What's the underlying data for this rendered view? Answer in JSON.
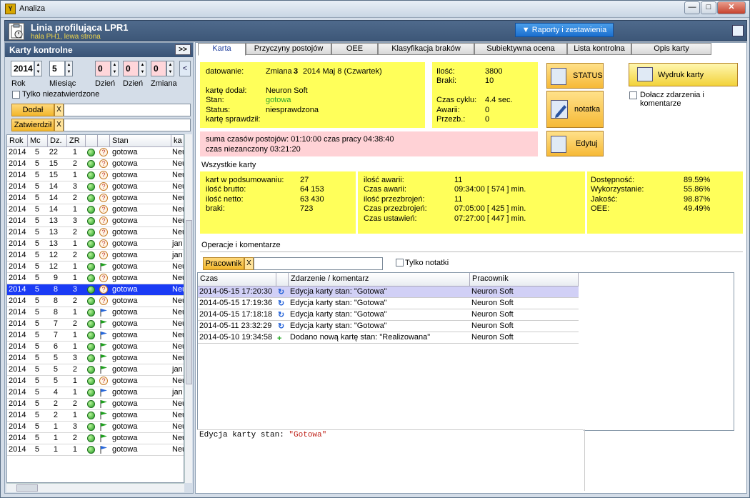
{
  "window": {
    "title": "Analiza",
    "app_icon_letters": "Y",
    "btn_min": "—",
    "btn_max": "□",
    "btn_close": "✕"
  },
  "header": {
    "title": "Linia profilująca LPR1",
    "subtitle": "hala PH1, lewa strona",
    "reports_button": "Raporty i zestawienia"
  },
  "left": {
    "panel_title": "Karty kontrolne",
    "expand_button": ">>",
    "year": "2014",
    "month": "5",
    "day1": "0",
    "day2": "0",
    "shift": "0",
    "collapse_button": "<",
    "label_year": "Rok",
    "label_month": "Miesiąc",
    "label_day1": "Dzień",
    "label_day2": "Dzień",
    "label_shift": "Zmiana",
    "only_unapproved": "Tylko niezatwierdzone",
    "added_button": "Dodał",
    "approved_button": "Zatwierdził",
    "x_label": "X",
    "columns": [
      "Rok",
      "Mc",
      "Dz.",
      "ZR",
      "",
      "",
      "Stan",
      "ka"
    ],
    "rows": [
      {
        "rok": "2014",
        "mc": "5",
        "dz": "22",
        "zr": "1",
        "status": "q",
        "stan": "gotowa",
        "ka": "Neu"
      },
      {
        "rok": "2014",
        "mc": "5",
        "dz": "15",
        "zr": "2",
        "status": "q",
        "stan": "gotowa",
        "ka": "Neu"
      },
      {
        "rok": "2014",
        "mc": "5",
        "dz": "15",
        "zr": "1",
        "status": "q",
        "stan": "gotowa",
        "ka": "Neu"
      },
      {
        "rok": "2014",
        "mc": "5",
        "dz": "14",
        "zr": "3",
        "status": "q",
        "stan": "gotowa",
        "ka": "Neu"
      },
      {
        "rok": "2014",
        "mc": "5",
        "dz": "14",
        "zr": "2",
        "status": "q",
        "stan": "gotowa",
        "ka": "Neu"
      },
      {
        "rok": "2014",
        "mc": "5",
        "dz": "14",
        "zr": "1",
        "status": "q",
        "stan": "gotowa",
        "ka": "Neu"
      },
      {
        "rok": "2014",
        "mc": "5",
        "dz": "13",
        "zr": "3",
        "status": "q",
        "stan": "gotowa",
        "ka": "Neu"
      },
      {
        "rok": "2014",
        "mc": "5",
        "dz": "13",
        "zr": "2",
        "status": "q",
        "stan": "gotowa",
        "ka": "Neu"
      },
      {
        "rok": "2014",
        "mc": "5",
        "dz": "13",
        "zr": "1",
        "status": "q",
        "stan": "gotowa",
        "ka": "jan"
      },
      {
        "rok": "2014",
        "mc": "5",
        "dz": "12",
        "zr": "2",
        "status": "q",
        "stan": "gotowa",
        "ka": "jan"
      },
      {
        "rok": "2014",
        "mc": "5",
        "dz": "12",
        "zr": "1",
        "status": "flag-green",
        "stan": "gotowa",
        "ka": "Neu"
      },
      {
        "rok": "2014",
        "mc": "5",
        "dz": "9",
        "zr": "1",
        "status": "q",
        "stan": "gotowa",
        "ka": "Neu"
      },
      {
        "rok": "2014",
        "mc": "5",
        "dz": "8",
        "zr": "3",
        "status": "q",
        "stan": "gotowa",
        "ka": "Neu",
        "selected": true
      },
      {
        "rok": "2014",
        "mc": "5",
        "dz": "8",
        "zr": "2",
        "status": "q",
        "stan": "gotowa",
        "ka": "Neu"
      },
      {
        "rok": "2014",
        "mc": "5",
        "dz": "8",
        "zr": "1",
        "status": "flag-blue",
        "stan": "gotowa",
        "ka": "Neu"
      },
      {
        "rok": "2014",
        "mc": "5",
        "dz": "7",
        "zr": "2",
        "status": "flag-green",
        "stan": "gotowa",
        "ka": "Neu"
      },
      {
        "rok": "2014",
        "mc": "5",
        "dz": "7",
        "zr": "1",
        "status": "flag-blue",
        "stan": "gotowa",
        "ka": "Neu"
      },
      {
        "rok": "2014",
        "mc": "5",
        "dz": "6",
        "zr": "1",
        "status": "flag-green",
        "stan": "gotowa",
        "ka": "Neu"
      },
      {
        "rok": "2014",
        "mc": "5",
        "dz": "5",
        "zr": "3",
        "status": "flag-green",
        "stan": "gotowa",
        "ka": "Neu"
      },
      {
        "rok": "2014",
        "mc": "5",
        "dz": "5",
        "zr": "2",
        "status": "flag-green",
        "stan": "gotowa",
        "ka": "jan"
      },
      {
        "rok": "2014",
        "mc": "5",
        "dz": "5",
        "zr": "1",
        "status": "q",
        "stan": "gotowa",
        "ka": "Neu"
      },
      {
        "rok": "2014",
        "mc": "5",
        "dz": "4",
        "zr": "1",
        "status": "flag-blue",
        "stan": "gotowa",
        "ka": "jan"
      },
      {
        "rok": "2014",
        "mc": "5",
        "dz": "2",
        "zr": "2",
        "status": "flag-green",
        "stan": "gotowa",
        "ka": "Neu"
      },
      {
        "rok": "2014",
        "mc": "5",
        "dz": "2",
        "zr": "1",
        "status": "flag-green",
        "stan": "gotowa",
        "ka": "Neu"
      },
      {
        "rok": "2014",
        "mc": "5",
        "dz": "1",
        "zr": "3",
        "status": "flag-green",
        "stan": "gotowa",
        "ka": "Neu"
      },
      {
        "rok": "2014",
        "mc": "5",
        "dz": "1",
        "zr": "2",
        "status": "flag-green",
        "stan": "gotowa",
        "ka": "Neu"
      },
      {
        "rok": "2014",
        "mc": "5",
        "dz": "1",
        "zr": "1",
        "status": "flag-blue",
        "stan": "gotowa",
        "ka": "Neu"
      }
    ]
  },
  "tabs": [
    "Karta",
    "Przyczyny postojów",
    "OEE",
    "Klasyfikacja braków",
    "Subiektywna ocena",
    "Lista kontrolna",
    "Opis karty"
  ],
  "card": {
    "datowanie_label": "datowanie:",
    "shift_text": "Zmiana",
    "shift_num": "3",
    "date_text": "2014  Maj  8 (Czwartek)",
    "added_label": "kartę dodał:",
    "added_value": "Neuron  Soft",
    "state_label": "Stan:",
    "state_value": "gotowa",
    "status_label": "Status:",
    "status_value": "niesprawdzona",
    "checked_label": "kartę sprawdził:",
    "qty_label": "Ilość:",
    "qty_value": "3800",
    "scrap_label": "Braki:",
    "scrap_value": "10",
    "cycle_label": "Czas cyklu:",
    "cycle_value": "4.4 sec.",
    "fail_label": "Awarii:",
    "fail_value": "0",
    "changeover_label": "Przezb.:",
    "changeover_value": "0",
    "downtime_line1": "suma czasów postojów: 01:10:00  czas pracy 04:38:40",
    "downtime_line2": "czas niezanczony 03:21:20",
    "btn_status": "STATUS",
    "btn_note": "notatka",
    "btn_edit": "Edytuj",
    "btn_print": "Wydruk karty",
    "attach_label": "Dołacz zdarzenia i komentarze"
  },
  "summary": {
    "title": "Wszystkie karty",
    "col1": [
      [
        "kart w podsumowaniu:",
        "27"
      ],
      [
        "ilość brutto:",
        "64 153"
      ],
      [
        "ilość netto:",
        "63 430"
      ],
      [
        "braki:",
        "723"
      ]
    ],
    "col2": [
      [
        "ilość awarii:",
        "11"
      ],
      [
        "Czas awarii:",
        "09:34:00 [ 574 ] min."
      ],
      [
        "ilość przezbrojeń:",
        "11"
      ],
      [
        "Czas przezbrojeń:",
        "07:05:00 [ 425 ] min."
      ],
      [
        "Czas ustawień:",
        "07:27:00 [ 447 ] min."
      ]
    ],
    "col3": [
      [
        "Dostępność:",
        "89.59%"
      ],
      [
        "Wykorzystanie:",
        "55.86%"
      ],
      [
        "Jakość:",
        "98.87%"
      ],
      [
        "OEE:",
        "49.49%"
      ]
    ]
  },
  "ops": {
    "title": "Operacje i komentarze",
    "worker_button": "Pracownik",
    "x_label": "X",
    "only_notes": "Tylko notatki",
    "columns": [
      "Czas",
      "",
      "Zdarzenie / komentarz",
      "Pracownik"
    ],
    "rows": [
      {
        "time": "2014-05-15  17:20:30",
        "icon": "refresh",
        "event": "Edycja karty  stan: \"Gotowa\"",
        "worker": "Neuron  Soft",
        "selected": true
      },
      {
        "time": "2014-05-15  17:19:36",
        "icon": "refresh",
        "event": "Edycja karty  stan: \"Gotowa\"",
        "worker": "Neuron  Soft"
      },
      {
        "time": "2014-05-15  17:18:18",
        "icon": "refresh",
        "event": "Edycja karty  stan: \"Gotowa\"",
        "worker": "Neuron  Soft"
      },
      {
        "time": "2014-05-11  23:32:29",
        "icon": "refresh",
        "event": "Edycja karty  stan: \"Gotowa\"",
        "worker": "Neuron  Soft"
      },
      {
        "time": "2014-05-10  19:34:58",
        "icon": "plus",
        "event": "Dodano nową kartę  stan: \"Realizowana\"",
        "worker": "Neuron  Soft"
      }
    ],
    "detail_prefix": "Edycja karty  stan: ",
    "detail_value": "\"Gotowa\""
  },
  "colors": {
    "yellow_panel": "#ffff5a",
    "pink_panel": "#ffd2d6",
    "selected_row": "#1a3bf5",
    "state_green": "#2aa32a"
  }
}
